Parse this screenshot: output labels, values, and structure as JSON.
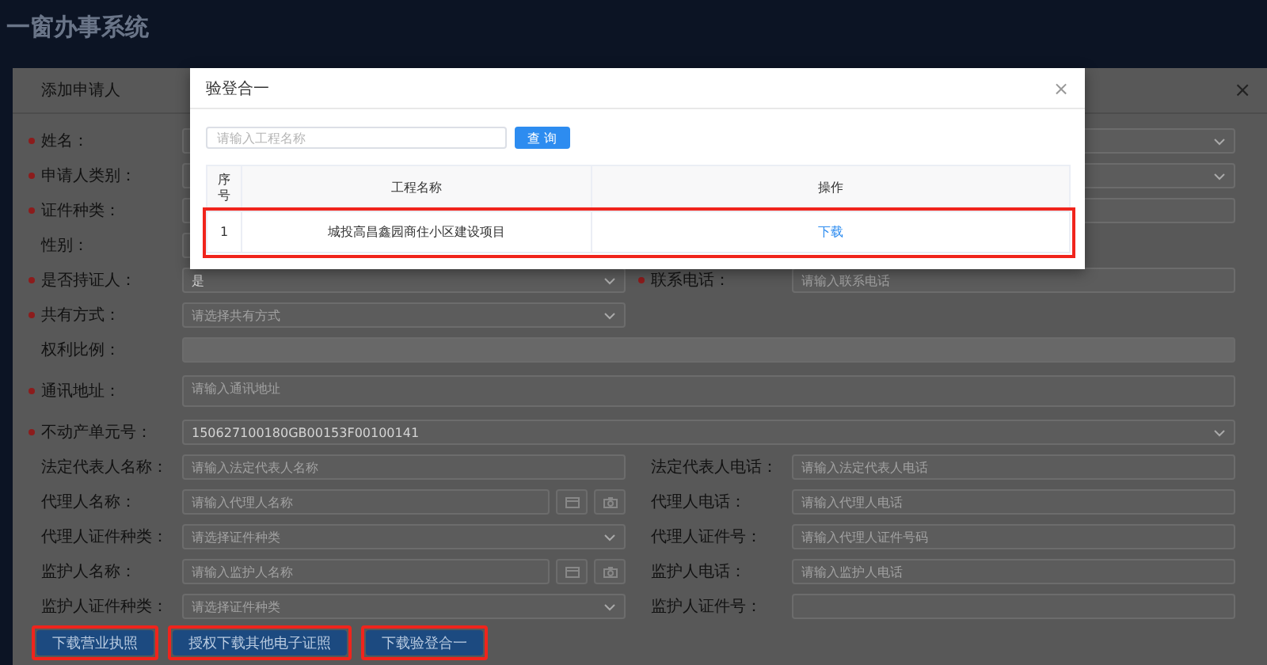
{
  "app": {
    "title": "一窗办事系统"
  },
  "dialog": {
    "title": "添加申请人",
    "close": "×",
    "rows": [
      {
        "left": {
          "label": "姓名：",
          "required": true,
          "kind": "blank"
        },
        "right": {
          "kind": "select"
        }
      },
      {
        "left": {
          "label": "申请人类别：",
          "required": true,
          "kind": "blank"
        },
        "right": {
          "kind": "select"
        }
      },
      {
        "left": {
          "label": "证件种类：",
          "required": true,
          "kind": "blank"
        },
        "right": {
          "kind": "input"
        }
      },
      {
        "left": {
          "label": "性别：",
          "required": false,
          "kind": "blank"
        }
      },
      {
        "left": {
          "label": "是否持证人：",
          "required": true,
          "kind": "select",
          "value": "是"
        },
        "right": {
          "label": "联系电话：",
          "required": true,
          "kind": "input",
          "placeholder": "请输入联系电话"
        }
      },
      {
        "left": {
          "label": "共有方式：",
          "required": true,
          "kind": "select",
          "placeholder": "请选择共有方式"
        }
      },
      {
        "full": {
          "label": "权利比例：",
          "required": false,
          "kind": "disabled"
        }
      },
      {
        "full": {
          "label": "通讯地址：",
          "required": true,
          "kind": "textarea",
          "placeholder": "请输入通讯地址"
        }
      },
      {
        "full": {
          "label": "不动产单元号：",
          "required": true,
          "kind": "select",
          "value": "150627100180GB00153F00100141"
        }
      },
      {
        "left": {
          "label": "法定代表人名称：",
          "required": false,
          "kind": "input",
          "placeholder": "请输入法定代表人名称"
        },
        "right": {
          "label": "法定代表人电话：",
          "required": false,
          "kind": "input",
          "placeholder": "请输入法定代表人电话"
        }
      },
      {
        "left": {
          "label": "代理人名称：",
          "required": false,
          "kind": "reader",
          "placeholder": "请输入代理人名称"
        },
        "right": {
          "label": "代理人电话：",
          "required": false,
          "kind": "input",
          "placeholder": "请输入代理人电话"
        }
      },
      {
        "left": {
          "label": "代理人证件种类：",
          "required": false,
          "kind": "select",
          "placeholder": "请选择证件种类"
        },
        "right": {
          "label": "代理人证件号：",
          "required": false,
          "kind": "input",
          "placeholder": "请输入代理人证件号码"
        }
      },
      {
        "left": {
          "label": "监护人名称：",
          "required": false,
          "kind": "reader",
          "placeholder": "请输入监护人名称"
        },
        "right": {
          "label": "监护人电话：",
          "required": false,
          "kind": "input",
          "placeholder": "请输入监护人电话"
        }
      },
      {
        "left": {
          "label": "监护人证件种类：",
          "required": false,
          "kind": "select",
          "placeholder": "请选择证件种类"
        },
        "right": {
          "label": "监护人证件号：",
          "required": false,
          "kind": "input"
        }
      }
    ],
    "buttons": [
      {
        "label": "下载营业执照",
        "highlighted": true
      },
      {
        "label": "授权下载其他电子证照",
        "highlighted": true
      },
      {
        "label": "下载验登合一",
        "highlighted": true
      }
    ]
  },
  "modal": {
    "title": "验登合一",
    "close": "×",
    "search": {
      "placeholder": "请输入工程名称"
    },
    "search_button": "查 询",
    "table": {
      "columns": [
        "序号",
        "工程名称",
        "操作"
      ],
      "rows": [
        {
          "cells": [
            "1",
            "城投高昌鑫园商住小区建设项目"
          ],
          "action": "下载",
          "highlighted": true
        }
      ]
    }
  }
}
